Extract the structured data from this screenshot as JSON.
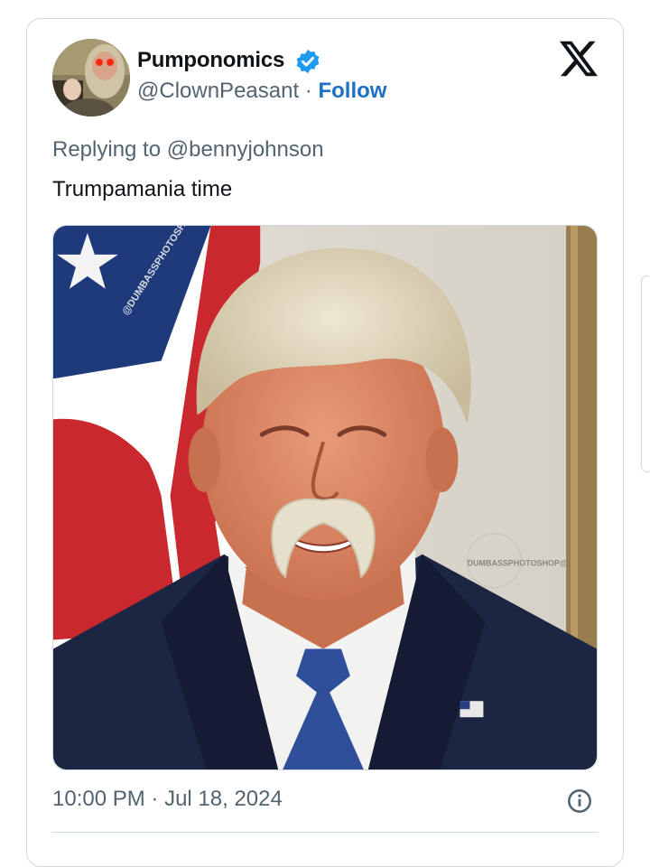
{
  "tweet": {
    "display_name": "Pumponomics",
    "handle": "@ClownPeasant",
    "separator": "·",
    "follow_label": "Follow",
    "replying_prefix": "Replying to ",
    "replying_to": "@bennyjohnson",
    "text": "Trumpamania time",
    "time": "10:00 PM",
    "date": "Jul 18, 2024"
  },
  "icons": {
    "verified": "verified-badge-icon",
    "brand": "x-logo-icon",
    "info": "info-icon"
  },
  "watermarks": {
    "left": "@DUMBASSPHOTOSHOP",
    "circle": "DUMBASSPHOTOSHOP@"
  },
  "colors": {
    "secondary_text": "#536471",
    "link": "#1d71c4",
    "verified": "#1d9bf0",
    "border": "#cfd9de"
  }
}
